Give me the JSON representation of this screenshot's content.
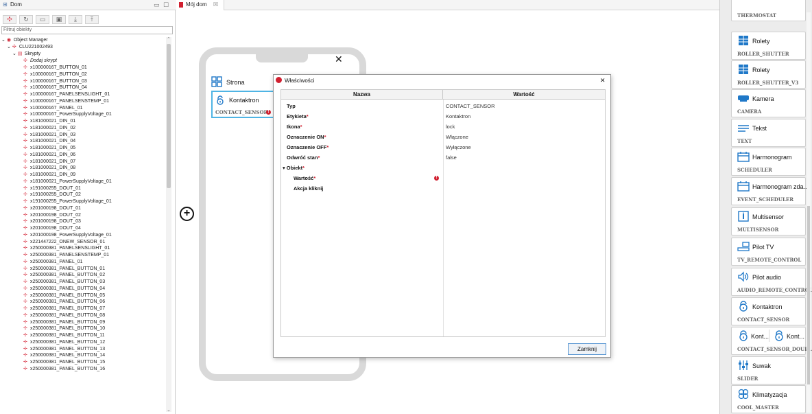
{
  "left_panel": {
    "tab_title": "Dom",
    "filter_placeholder": "Filtruj obiekty",
    "tree": {
      "root": "Object Manager",
      "device": "CLU221002493",
      "scripts_folder": "Skrypty",
      "add_script": "Dodaj skrypt",
      "objects": [
        "x100000167_BUTTON_01",
        "x100000167_BUTTON_02",
        "x100000167_BUTTON_03",
        "x100000167_BUTTON_04",
        "x100000167_PANELSENSLIGHT_01",
        "x100000167_PANELSENSTEMP_01",
        "x100000167_PANEL_01",
        "x100000167_PowerSupplyVoltage_01",
        "x181000021_DIN_01",
        "x181000021_DIN_02",
        "x181000021_DIN_03",
        "x181000021_DIN_04",
        "x181000021_DIN_05",
        "x181000021_DIN_06",
        "x181000021_DIN_07",
        "x181000021_DIN_08",
        "x181000021_DIN_09",
        "x181000021_PowerSupplyVoltage_01",
        "x191000255_DOUT_01",
        "x191000255_DOUT_02",
        "x191000255_PowerSupplyVoltage_01",
        "x201000198_DOUT_01",
        "x201000198_DOUT_02",
        "x201000198_DOUT_03",
        "x201000198_DOUT_04",
        "x201000198_PowerSupplyVoltage_01",
        "x221447222_ONEW_SENSOR_01",
        "x250000381_PANELSENSLIGHT_01",
        "x250000381_PANELSENSTEMP_01",
        "x250000381_PANEL_01",
        "x250000381_PANEL_BUTTON_01",
        "x250000381_PANEL_BUTTON_02",
        "x250000381_PANEL_BUTTON_03",
        "x250000381_PANEL_BUTTON_04",
        "x250000381_PANEL_BUTTON_05",
        "x250000381_PANEL_BUTTON_06",
        "x250000381_PANEL_BUTTON_07",
        "x250000381_PANEL_BUTTON_08",
        "x250000381_PANEL_BUTTON_09",
        "x250000381_PANEL_BUTTON_10",
        "x250000381_PANEL_BUTTON_11",
        "x250000381_PANEL_BUTTON_12",
        "x250000381_PANEL_BUTTON_13",
        "x250000381_PANEL_BUTTON_14",
        "x250000381_PANEL_BUTTON_15",
        "x250000381_PANEL_BUTTON_16"
      ]
    }
  },
  "editor": {
    "tab_title": "Mój dom",
    "tab_close": "☒",
    "phone_close": "✕",
    "add_symbol": "⊕",
    "tiles": {
      "strona_label": "Strona",
      "kontaktron_label": "Kontaktron",
      "kontaktron_code": "CONTACT_SENSOR"
    }
  },
  "dialog": {
    "title": "Właściwości",
    "close_x": "✕",
    "col_name": "Nazwa",
    "col_value": "Wartość",
    "rows": [
      {
        "name": "Typ",
        "required": "",
        "value": "CONTACT_SENSOR"
      },
      {
        "name": "Etykieta",
        "required": "*",
        "value": "Kontaktron"
      },
      {
        "name": "Ikona",
        "required": "*",
        "value": "lock"
      },
      {
        "name": "Oznaczenie ON",
        "required": "*",
        "value": "Włączone"
      },
      {
        "name": "Oznaczenie OFF",
        "required": "*",
        "value": "Wyłączone"
      },
      {
        "name": "Odwróć stan",
        "required": "*",
        "value": "false"
      },
      {
        "name": "Obiekt",
        "required": "*",
        "value": ""
      },
      {
        "name": "Wartość",
        "required": "*",
        "value": ""
      },
      {
        "name": "Akcja kliknij",
        "required": "",
        "value": ""
      }
    ],
    "error_mark": "!",
    "expand_arrow": "▾",
    "close_button": "Zamknij"
  },
  "palette": {
    "items": [
      {
        "label": "",
        "code": "THERMOSTAT",
        "icon": "thermostat-icon"
      },
      {
        "label": "Rolety",
        "code": "ROLLER_SHUTTER",
        "icon": "roller-shutter-icon"
      },
      {
        "label": "Rolety",
        "code": "ROLLER_SHUTTER_V3",
        "icon": "roller-shutter-icon"
      },
      {
        "label": "Kamera",
        "code": "CAMERA",
        "icon": "camera-icon"
      },
      {
        "label": "Tekst",
        "code": "TEXT",
        "icon": "text-icon"
      },
      {
        "label": "Harmonogram",
        "code": "SCHEDULER",
        "icon": "calendar-icon"
      },
      {
        "label": "Harmonogram zda...",
        "code": "EVENT_SCHEDULER",
        "icon": "calendar-icon"
      },
      {
        "label": "Multisensor",
        "code": "MULTISENSOR",
        "icon": "multisensor-icon"
      },
      {
        "label": "Pilot TV",
        "code": "TV_REMOTE_CONTROL",
        "icon": "tv-remote-icon"
      },
      {
        "label": "Pilot audio",
        "code": "AUDIO_REMOTE_CONTROL",
        "icon": "speaker-icon"
      },
      {
        "label": "Kontaktron",
        "code": "CONTACT_SENSOR",
        "icon": "lock-icon"
      },
      {
        "label": "Kont...",
        "label2": "Kont...",
        "code": "CONTACT_SENSOR_DOUBLE",
        "icon": "lock-icon"
      },
      {
        "label": "Suwak",
        "code": "SLIDER",
        "icon": "slider-icon"
      },
      {
        "label": "Klimatyzacja",
        "code": "COOL_MASTER",
        "icon": "fan-icon"
      }
    ]
  },
  "colors": {
    "accent_red": "#d12030",
    "selection_blue": "#4fb4e4",
    "palette_icon_blue": "#1f78c8"
  }
}
